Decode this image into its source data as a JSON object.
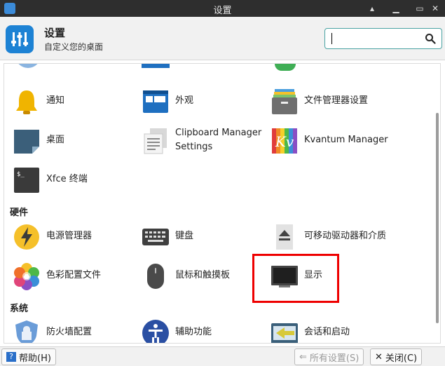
{
  "window": {
    "title": "设置"
  },
  "header": {
    "title": "设置",
    "subtitle": "自定义您的桌面"
  },
  "search": {
    "value": "",
    "placeholder": ""
  },
  "sections": {
    "hardware": "硬件",
    "system": "系统"
  },
  "items": {
    "notifications": "通知",
    "appearance": "外观",
    "file_manager_settings": "文件管理器设置",
    "desktop": "桌面",
    "clipboard_manager": "Clipboard Manager Settings",
    "kvantum": "Kvantum Manager",
    "xfce_terminal": "Xfce 终端",
    "power_manager": "电源管理器",
    "keyboard": "键盘",
    "removable_drives": "可移动驱动器和介质",
    "color_profiles": "色彩配置文件",
    "mouse_touchpad": "鼠标和触摸板",
    "display": "显示",
    "firewall": "防火墙配置",
    "accessibility": "辅助功能",
    "session_startup": "会话和启动"
  },
  "bottom": {
    "help": "帮助(H)",
    "all_settings": "所有设置(S)",
    "close": "关闭(C)"
  },
  "colors": {
    "highlight": "#e00000",
    "search_border": "#4aa3a3",
    "titlebar": "#2e2e2e"
  }
}
